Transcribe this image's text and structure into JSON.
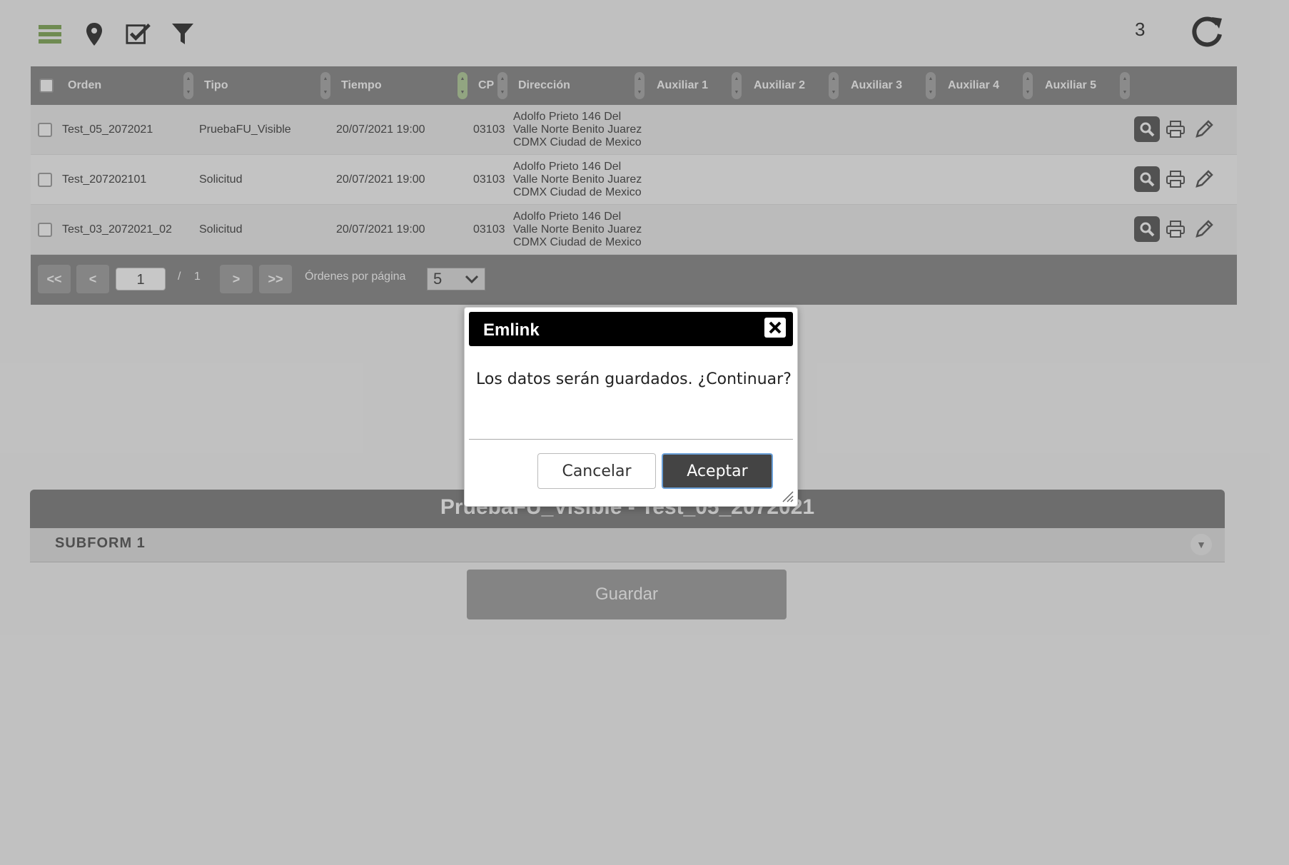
{
  "toolbar": {
    "icons": [
      "menu-icon",
      "location-pin-icon",
      "checklist-icon",
      "filter-icon"
    ],
    "counter": "3",
    "refresh_icon": "refresh-icon"
  },
  "grid": {
    "headers": [
      "Orden",
      "Tipo",
      "Tiempo",
      "CP",
      "Dirección",
      "Auxiliar 1",
      "Auxiliar 2",
      "Auxiliar 3",
      "Auxiliar 4",
      "Auxiliar 5"
    ],
    "rows": [
      {
        "orden": "Test_05_2072021",
        "tipo": "PruebaFU_Visible",
        "tiempo": "20/07/2021 19:00",
        "cp": "03103",
        "direccion_1": "Adolfo Prieto 146 Del",
        "direccion_2": "Valle Norte Benito Juarez",
        "direccion_3": "CDMX Ciudad de Mexico"
      },
      {
        "orden": "Test_207202101",
        "tipo": "Solicitud",
        "tiempo": "20/07/2021 19:00",
        "cp": "03103",
        "direccion_1": "Adolfo Prieto 146 Del",
        "direccion_2": "Valle Norte Benito Juarez",
        "direccion_3": "CDMX Ciudad de Mexico"
      },
      {
        "orden": "Test_03_2072021_02",
        "tipo": "Solicitud",
        "tiempo": "20/07/2021 19:00",
        "cp": "03103",
        "direccion_1": "Adolfo Prieto 146 Del",
        "direccion_2": "Valle Norte Benito Juarez",
        "direccion_3": "CDMX Ciudad de Mexico"
      }
    ]
  },
  "pager": {
    "first": "<<",
    "prev": "<",
    "page": "1",
    "separator": "/",
    "total": "1",
    "next": ">",
    "last": ">>",
    "per_page_label": "Órdenes por página",
    "per_page_value": "5"
  },
  "form": {
    "title": "PruebaFU_Visible - Test_05_2072021",
    "subform_label": "SUBFORM 1",
    "save_label": "Guardar"
  },
  "dialog": {
    "title": "Emlink",
    "message": "Los datos serán guardados. ¿Continuar?",
    "cancel_label": "Cancelar",
    "ok_label": "Aceptar"
  },
  "colors": {
    "accent_green": "#8fb36a",
    "header_gray": "#959595",
    "dialog_title_bg": "#000000",
    "ok_button_bg": "#444444"
  }
}
